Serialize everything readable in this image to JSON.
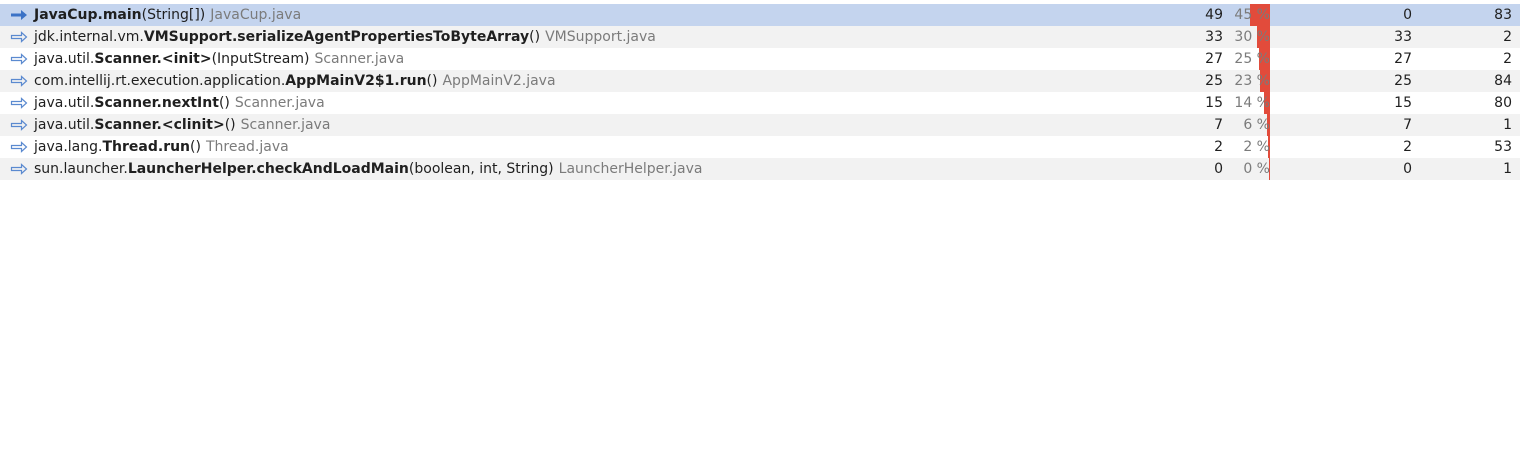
{
  "colors": {
    "selected_row": "#c4d4ee",
    "alt_row": "#f2f2f2",
    "bar": "#e24b3b",
    "arrow_selected": "#3b72c6",
    "arrow": "#5b8ad0"
  },
  "icons": {
    "row_arrow": "arrow-right-icon"
  },
  "rows": [
    {
      "pkg": "",
      "cls": "JavaCup",
      "sep": ".",
      "method": "main",
      "args": "(String[])",
      "file": "JavaCup.java",
      "self": "49",
      "pct": "45 %",
      "pct_value": 45,
      "total": "0",
      "calls": "83",
      "selected": true
    },
    {
      "pkg": "jdk.internal.vm.",
      "cls": "VMSupport",
      "sep": ".",
      "method": "serializeAgentPropertiesToByteArray",
      "args": "()",
      "file": "VMSupport.java",
      "self": "33",
      "pct": "30 %",
      "pct_value": 30,
      "total": "33",
      "calls": "2"
    },
    {
      "pkg": "java.util.",
      "cls": "Scanner",
      "sep": ".",
      "method": "<init>",
      "args": "(InputStream)",
      "file": "Scanner.java",
      "self": "27",
      "pct": "25 %",
      "pct_value": 25,
      "total": "27",
      "calls": "2"
    },
    {
      "pkg": "com.intellij.rt.execution.application.",
      "cls": "AppMainV2$1",
      "sep": ".",
      "method": "run",
      "args": "()",
      "file": "AppMainV2.java",
      "self": "25",
      "pct": "23 %",
      "pct_value": 23,
      "total": "25",
      "calls": "84"
    },
    {
      "pkg": "java.util.",
      "cls": "Scanner",
      "sep": ".",
      "method": "nextInt",
      "args": "()",
      "file": "Scanner.java",
      "self": "15",
      "pct": "14 %",
      "pct_value": 14,
      "total": "15",
      "calls": "80"
    },
    {
      "pkg": "java.util.",
      "cls": "Scanner",
      "sep": ".",
      "method": "<clinit>",
      "args": "()",
      "file": "Scanner.java",
      "self": "7",
      "pct": "6 %",
      "pct_value": 6,
      "total": "7",
      "calls": "1"
    },
    {
      "pkg": "java.lang.",
      "cls": "Thread",
      "sep": ".",
      "method": "run",
      "args": "()",
      "file": "Thread.java",
      "self": "2",
      "pct": "2 %",
      "pct_value": 2,
      "total": "2",
      "calls": "53"
    },
    {
      "pkg": "sun.launcher.",
      "cls": "LauncherHelper",
      "sep": ".",
      "method": "checkAndLoadMain",
      "args": "(boolean, int, String)",
      "file": "LauncherHelper.java",
      "self": "0",
      "pct": "0 %",
      "pct_value": 0,
      "total": "0",
      "calls": "1"
    }
  ]
}
